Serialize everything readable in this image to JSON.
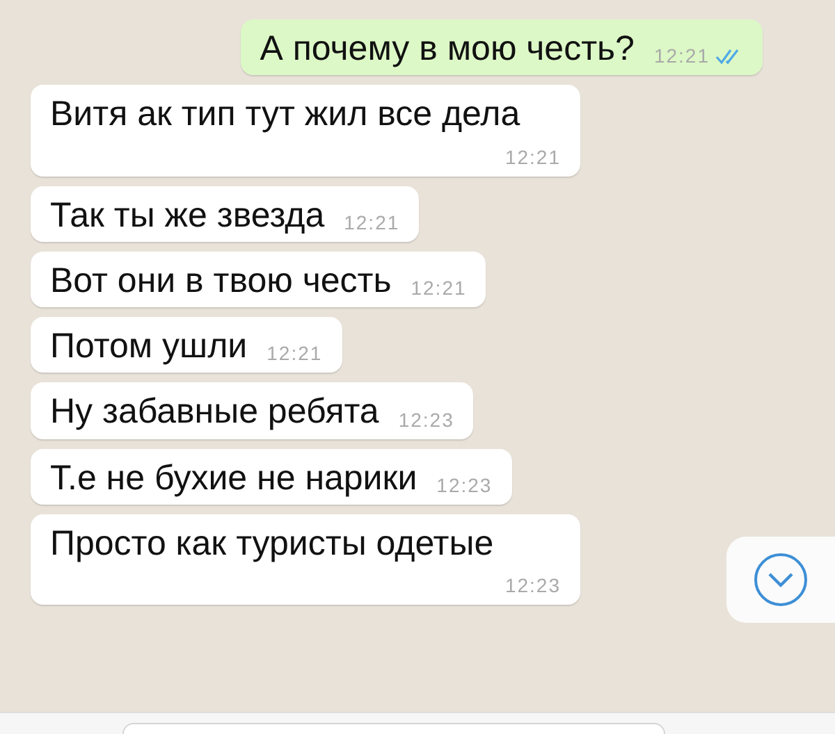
{
  "messages": [
    {
      "outgoing": true,
      "text": "А почему в мою честь?",
      "time": "12:21",
      "read": true
    },
    {
      "outgoing": false,
      "text": "Витя ак тип тут жил все дела",
      "time": "12:21"
    },
    {
      "outgoing": false,
      "text": "Так ты же звезда",
      "time": "12:21"
    },
    {
      "outgoing": false,
      "text": "Вот они в твою честь",
      "time": "12:21"
    },
    {
      "outgoing": false,
      "text": "Потом ушли",
      "time": "12:21"
    },
    {
      "outgoing": false,
      "text": "Ну забавные ребята",
      "time": "12:23"
    },
    {
      "outgoing": false,
      "text": "Т.е не бухие не нарики",
      "time": "12:23"
    },
    {
      "outgoing": false,
      "text": "Просто как туристы одетые",
      "time": "12:23"
    }
  ],
  "scroll_down_button": {
    "visible": true
  }
}
